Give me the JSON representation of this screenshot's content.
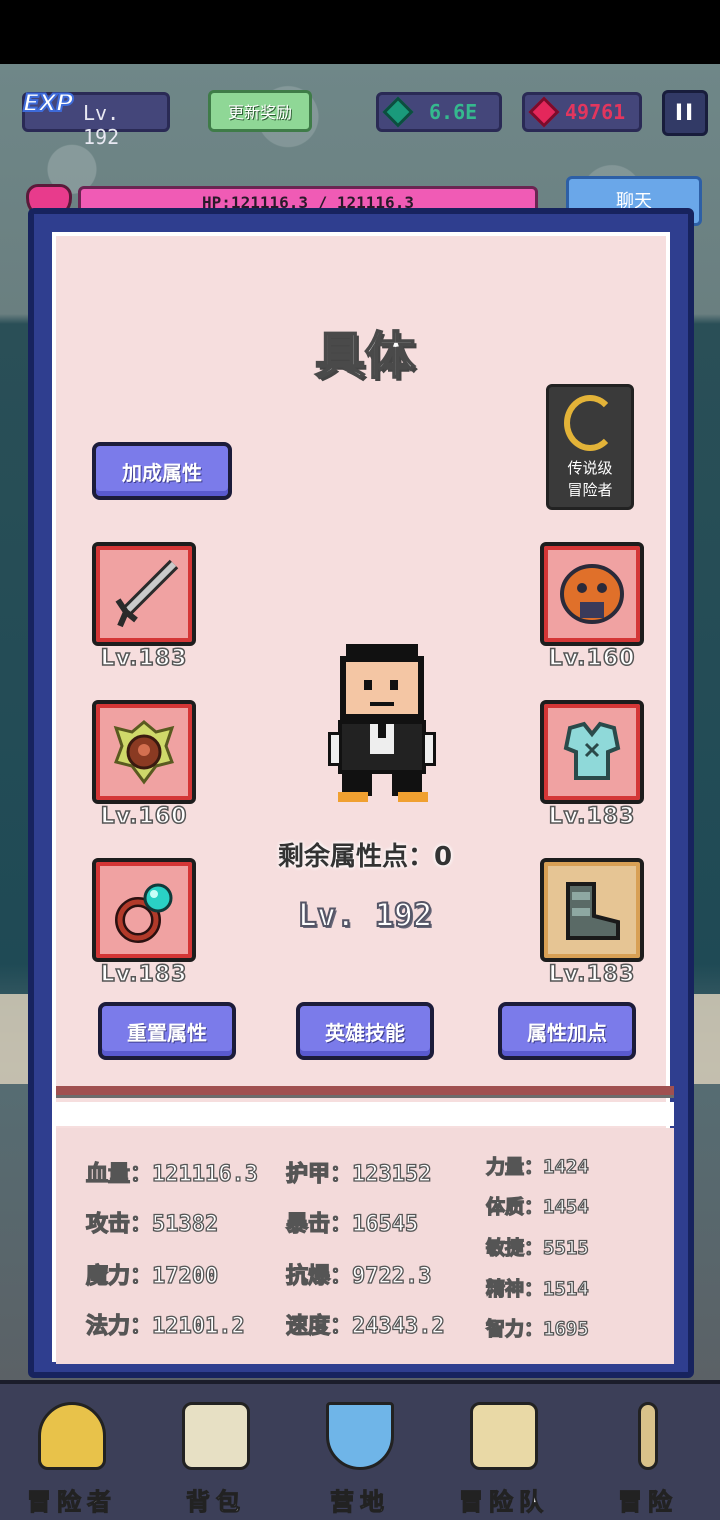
{
  "hud": {
    "exp_tag": "EXP",
    "level": "Lv. 192",
    "reward_label": "更新奖励",
    "gems": "6.6E",
    "rubies": "49761",
    "pause_label": "II",
    "chat_label": "聊天",
    "hp_text": "HP:121116.3 / 121116.3"
  },
  "panel": {
    "title": "具体",
    "bonus_button": "加成属性",
    "badge_line1": "传说级",
    "badge_line2": "冒险者",
    "equipment": [
      {
        "name": "weapon",
        "level": "Lv.183"
      },
      {
        "name": "helmet",
        "level": "Lv.160"
      },
      {
        "name": "emblem",
        "level": "Lv.160"
      },
      {
        "name": "armor",
        "level": "Lv.183"
      },
      {
        "name": "ring",
        "level": "Lv.183"
      },
      {
        "name": "boots",
        "level": "Lv.183"
      }
    ],
    "remaining_points": "剩余属性点：0",
    "hero_level": "Lv. 192",
    "buttons": [
      "重置属性",
      "英雄技能",
      "属性加点"
    ],
    "stats_left": [
      "血量：121116.3",
      "攻击：51382",
      "魔力：17200",
      "法力：12101.2"
    ],
    "stats_mid": [
      "护甲：123152",
      "暴击：16545",
      "抗爆：9722.3",
      "速度：24343.2"
    ],
    "stats_right": [
      "力量：1424",
      "体质：1454",
      "敏捷：5515",
      "精神：1514",
      "智力：1695"
    ]
  },
  "nav": [
    {
      "label": "冒险者",
      "icon": "helmet-icon"
    },
    {
      "label": "背包",
      "icon": "backpack-icon"
    },
    {
      "label": "营地",
      "icon": "camp-banner-icon"
    },
    {
      "label": "冒险队",
      "icon": "book-icon"
    },
    {
      "label": "冒险",
      "icon": "sword-icon"
    }
  ]
}
